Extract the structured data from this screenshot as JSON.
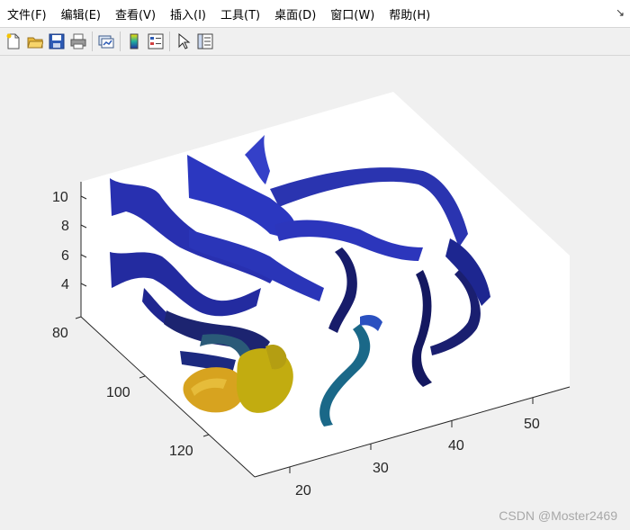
{
  "menubar": {
    "items": [
      {
        "label": "文件(F)"
      },
      {
        "label": "编辑(E)"
      },
      {
        "label": "查看(V)"
      },
      {
        "label": "插入(I)"
      },
      {
        "label": "工具(T)"
      },
      {
        "label": "桌面(D)"
      },
      {
        "label": "窗口(W)"
      },
      {
        "label": "帮助(H)"
      }
    ],
    "corner_icon": "dock-arrow-icon"
  },
  "toolbar": {
    "buttons": [
      {
        "icon": "new-figure-icon"
      },
      {
        "icon": "open-file-icon"
      },
      {
        "icon": "save-icon"
      },
      {
        "icon": "print-icon"
      },
      {
        "icon": "link-plot-icon"
      },
      {
        "icon": "insert-colorbar-icon"
      },
      {
        "icon": "insert-legend-icon"
      },
      {
        "icon": "edit-plot-cursor-icon"
      },
      {
        "icon": "property-inspector-icon"
      }
    ]
  },
  "axes": {
    "z_ticks": [
      "10",
      "8",
      "6",
      "4"
    ],
    "y_ticks": [
      "80",
      "100",
      "120"
    ],
    "x_ticks": [
      "20",
      "30",
      "40",
      "50"
    ]
  },
  "colors": {
    "ribbon_blue": "#2b35b8",
    "ribbon_dark": "#151a5e",
    "teal": "#1a6e8a",
    "gold": "#d4a020",
    "olive_yellow": "#c9b010"
  },
  "watermark": "CSDN @Moster2469"
}
